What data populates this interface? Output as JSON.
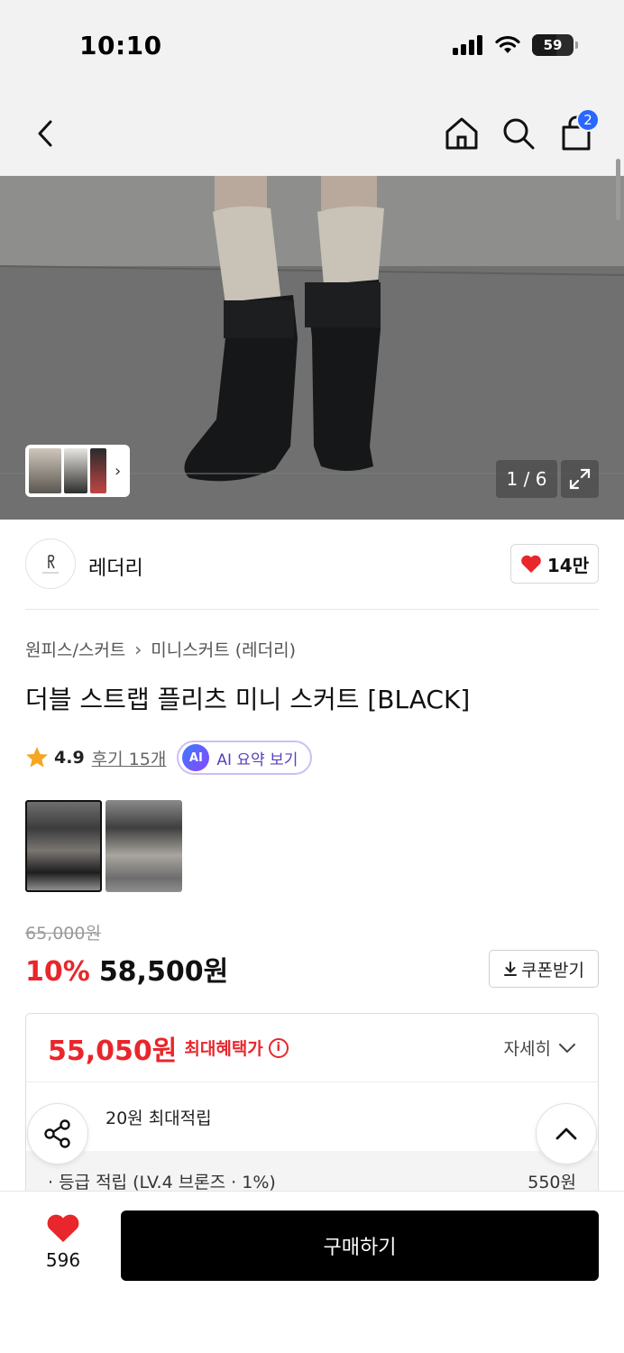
{
  "status_bar": {
    "time": "10:10",
    "battery": "59",
    "battery_level": 0.59
  },
  "nav": {
    "cart_count": "2"
  },
  "gallery": {
    "page_counter": "1 / 6"
  },
  "brand": {
    "name": "레더리",
    "likes": "14만"
  },
  "product": {
    "breadcrumb": [
      "원피스/스커트",
      "미니스커트 (레더리)"
    ],
    "title": "더블 스트랩 플리츠 미니 스커트 [BLACK]",
    "rating": "4.9",
    "reviews": "후기 15개",
    "ai_chip": "AI",
    "ai_summary": "AI 요약 보기"
  },
  "pricing": {
    "original_price": "65,000원",
    "discount": "10%",
    "sale_price": "58,500원",
    "coupon_label": "쿠폰받기"
  },
  "benefit": {
    "max_price": "55,050원",
    "max_label": "최대혜택가",
    "detail_label": "자세히",
    "points_text": "20원 최대적립",
    "points_lines": [
      {
        "label": "· 등급 적립 (LV.4 브론즈 · 1%)",
        "value": "550원"
      }
    ]
  },
  "bottom": {
    "wish_count": "596",
    "buy_label": "구매하기"
  },
  "colors": {
    "accent_red": "#e8262b",
    "badge_blue": "#2a67ff",
    "ai_purple": "#5a3fc0"
  }
}
